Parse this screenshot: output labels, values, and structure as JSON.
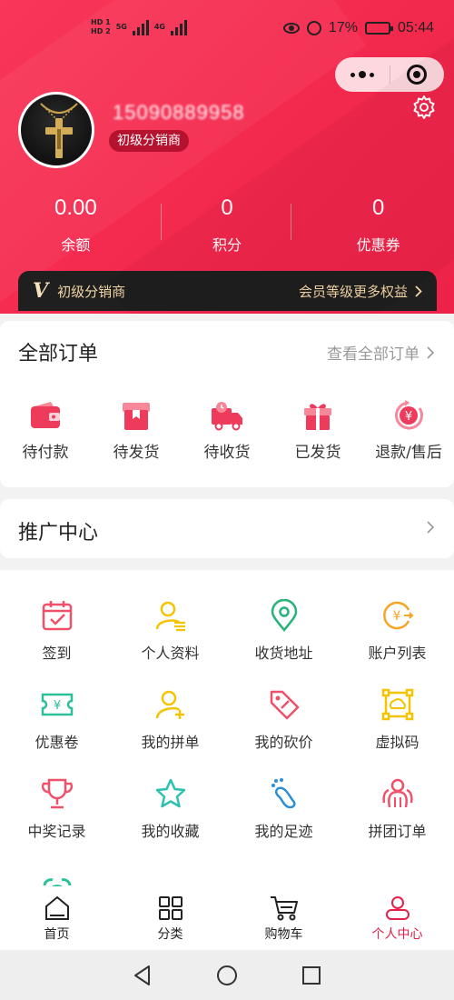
{
  "status_bar": {
    "sim1": "HD 1",
    "sim2": "HD 2",
    "net1": "5G",
    "net2": "4G",
    "battery": "17%",
    "time": "05:44"
  },
  "profile": {
    "phone": "15090889958",
    "level": "初级分销商"
  },
  "stats": [
    {
      "value": "0.00",
      "label": "余额"
    },
    {
      "value": "0",
      "label": "积分"
    },
    {
      "value": "0",
      "label": "优惠券"
    }
  ],
  "vip_bar": {
    "badge": "V",
    "level": "初级分销商",
    "link": "会员等级更多权益"
  },
  "orders": {
    "title": "全部订单",
    "view_all": "查看全部订单",
    "items": [
      {
        "label": "待付款",
        "icon": "wallet-icon"
      },
      {
        "label": "待发货",
        "icon": "package-icon"
      },
      {
        "label": "待收货",
        "icon": "delivery-truck-icon"
      },
      {
        "label": "已发货",
        "icon": "gift-icon"
      },
      {
        "label": "退款/售后",
        "icon": "refund-icon"
      }
    ]
  },
  "promo": {
    "title": "推广中心"
  },
  "grid": [
    {
      "label": "签到",
      "icon": "calendar-check-icon"
    },
    {
      "label": "个人资料",
      "icon": "user-profile-icon"
    },
    {
      "label": "收货地址",
      "icon": "location-pin-icon"
    },
    {
      "label": "账户列表",
      "icon": "yen-coin-icon"
    },
    {
      "label": "优惠卷",
      "icon": "coupon-icon"
    },
    {
      "label": "我的拼单",
      "icon": "user-add-icon"
    },
    {
      "label": "我的砍价",
      "icon": "price-tag-icon"
    },
    {
      "label": "虚拟码",
      "icon": "virtual-code-icon"
    },
    {
      "label": "中奖记录",
      "icon": "trophy-icon"
    },
    {
      "label": "我的收藏",
      "icon": "star-icon"
    },
    {
      "label": "我的足迹",
      "icon": "footprint-icon"
    },
    {
      "label": "拼团订单",
      "icon": "group-order-icon"
    }
  ],
  "tabs": [
    {
      "label": "首页",
      "icon": "home-icon"
    },
    {
      "label": "分类",
      "icon": "category-grid-icon"
    },
    {
      "label": "购物车",
      "icon": "cart-icon"
    },
    {
      "label": "个人中心",
      "icon": "person-icon",
      "active": true
    }
  ],
  "colors": {
    "brand_red": "#f0264b",
    "active_tab": "#e51f48",
    "vip_gold": "#f4d6a6"
  }
}
